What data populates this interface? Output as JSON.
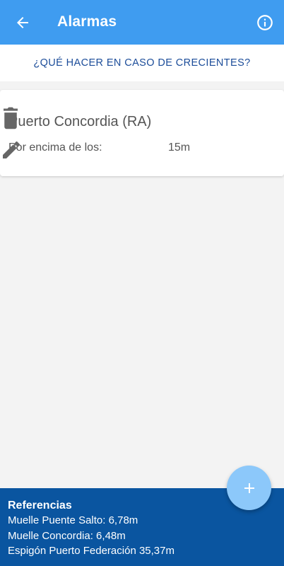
{
  "appbar": {
    "title": "Alarmas",
    "back_icon": "arrow-left-icon",
    "info_icon": "info-circle-icon",
    "color": "#3f9cf0"
  },
  "help_link": {
    "label": "¿QUÉ HACER EN CASO DE CRECIENTES?"
  },
  "alarm": {
    "station": "Puerto Concordia (RA)",
    "condition_label": "Por encima de los:",
    "condition_value": "15m",
    "delete_icon": "trash-icon",
    "edit_icon": "pencil-icon"
  },
  "references": {
    "heading": "Referencias",
    "items": [
      "Muelle Puente Salto: 6,78m",
      "Muelle Concordia: 6,48m",
      "Espigón Puerto Federación 35,37m"
    ],
    "color": "#0a55a0"
  },
  "fab": {
    "icon": "plus-icon",
    "color": "#8cc8fa"
  }
}
